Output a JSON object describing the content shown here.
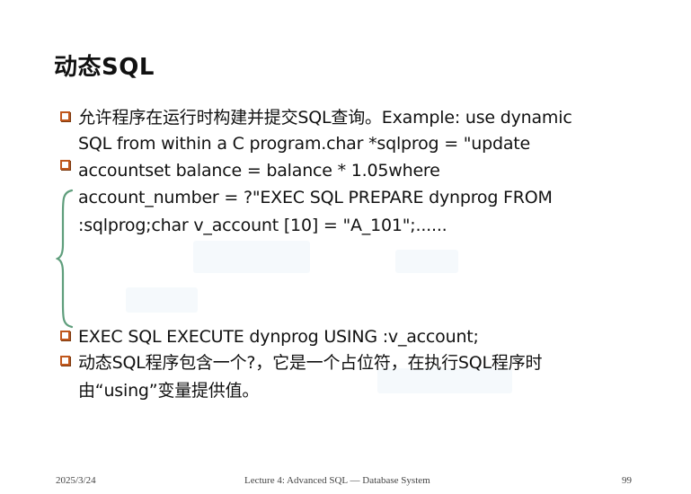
{
  "slide": {
    "title": "动态SQL",
    "paragraph1": {
      "lines": [
        "允许程序在运行时构建并提交SQL查询。Example: use dynamic",
        "SQL from within a C program.char *sqlprog = \"update",
        "accountset balance = balance * 1.05where",
        "account_number = ?\"EXEC SQL PREPARE dynprog FROM",
        ":sqlprog;char v_account [10] = \"A_101\";......"
      ]
    },
    "bullet_exec": "EXEC SQL EXECUTE dynprog USING :v_account;",
    "paragraph2": {
      "lines": [
        "动态SQL程序包含一个?，它是一个占位符，在执行SQL程序时",
        "由“using”变量提供值。"
      ]
    }
  },
  "footer": {
    "date": "2025/3/24",
    "lecture": "Lecture 4: Advanced SQL — Database System",
    "page_number": "99"
  },
  "colors": {
    "bullet_border": "#c0571c",
    "brace": "#5f9e7c"
  }
}
